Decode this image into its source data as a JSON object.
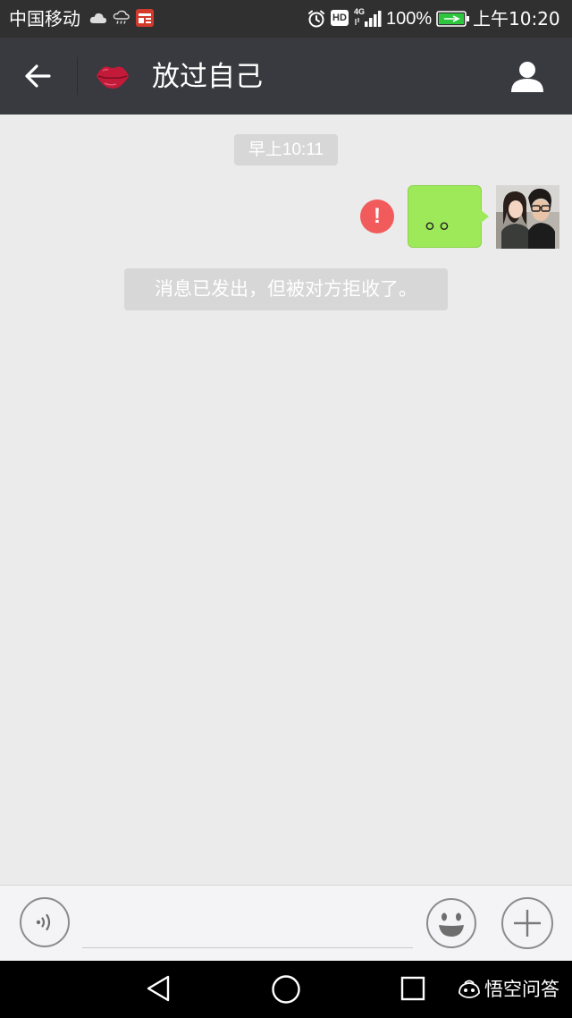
{
  "status_bar": {
    "carrier": "中国移动",
    "network": "4G",
    "battery_percent": "100%",
    "time": "上午10:20",
    "icons": [
      "cloud-icon",
      "rain-cloud-icon",
      "toutiao-app-icon",
      "alarm-icon",
      "hd-icon",
      "signal-icon",
      "battery-charging-icon"
    ],
    "hd_label": "HD"
  },
  "header": {
    "title": "放过自己",
    "back_icon": "arrow-left-icon",
    "profile_icon": "person-icon",
    "contact_icon": "lips-icon"
  },
  "chat": {
    "timestamp": "早上10:11",
    "messages": [
      {
        "sender": "me",
        "text": "。。",
        "status": "failed",
        "status_symbol": "!"
      }
    ],
    "system_notice": "消息已发出，但被对方拒收了。"
  },
  "input_bar": {
    "voice_icon": "voice-icon",
    "emoji_icon": "smiley-icon",
    "plus_icon": "plus-icon",
    "text_value": ""
  },
  "nav_bar": {
    "icons": [
      "nav-back-icon",
      "nav-home-icon",
      "nav-recent-icon"
    ]
  },
  "watermark": {
    "text": "悟空问答"
  },
  "colors": {
    "header_bg": "#393a3f",
    "status_bar_bg": "#303030",
    "chat_bg": "#ebebeb",
    "bubble_green": "#9ee959",
    "error_red": "#f25b5b",
    "system_notice_bg": "#d7d7d7"
  }
}
